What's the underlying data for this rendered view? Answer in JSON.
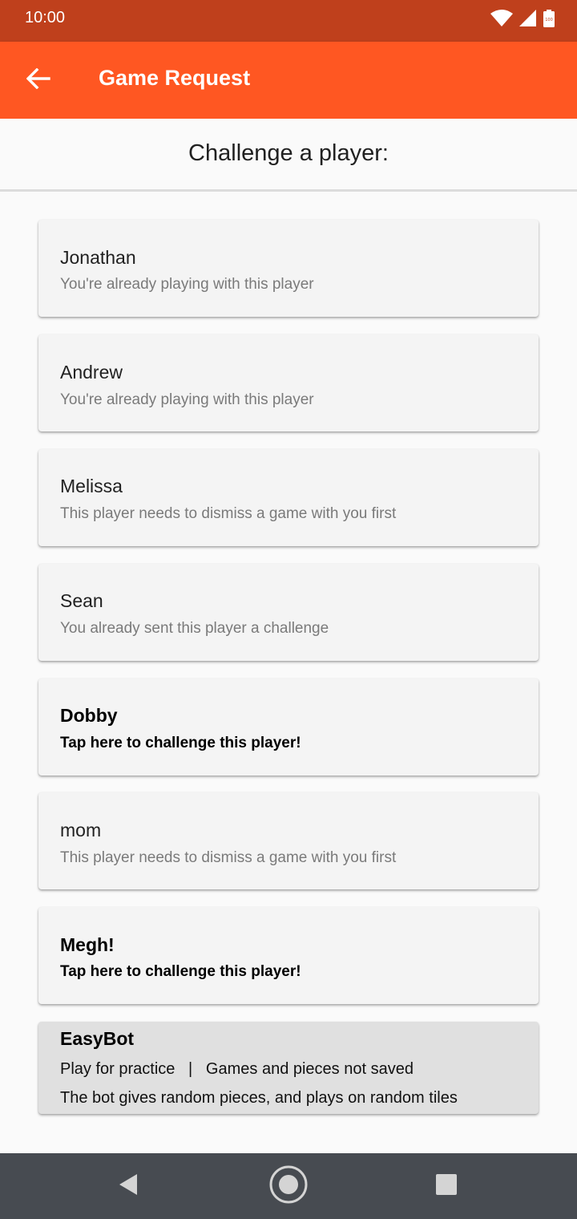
{
  "status_bar": {
    "time": "10:00",
    "battery_level": "100"
  },
  "app_bar": {
    "title": "Game Request"
  },
  "header": {
    "text": "Challenge a player:"
  },
  "players": [
    {
      "name": "Jonathan",
      "status": "You're already playing with this player"
    },
    {
      "name": "Andrew",
      "status": "You're already playing with this player"
    },
    {
      "name": "Melissa",
      "status": "This player needs to dismiss a game with you first"
    },
    {
      "name": "Sean",
      "status": "You already sent this player a challenge"
    },
    {
      "name": "Dobby",
      "status": "Tap here to challenge this player!"
    },
    {
      "name": "mom",
      "status": "This player needs to dismiss a game with you first"
    },
    {
      "name": "Megh!",
      "status": "Tap here to challenge this player!"
    }
  ],
  "bot": {
    "name": "EasyBot",
    "line1": "Play for practice   |   Games and pieces not saved",
    "line2": "The bot gives random pieces, and plays on random tiles"
  },
  "colors": {
    "status_bar": "#bf401c",
    "app_bar": "#ff5722",
    "nav_bar": "#474b51"
  }
}
